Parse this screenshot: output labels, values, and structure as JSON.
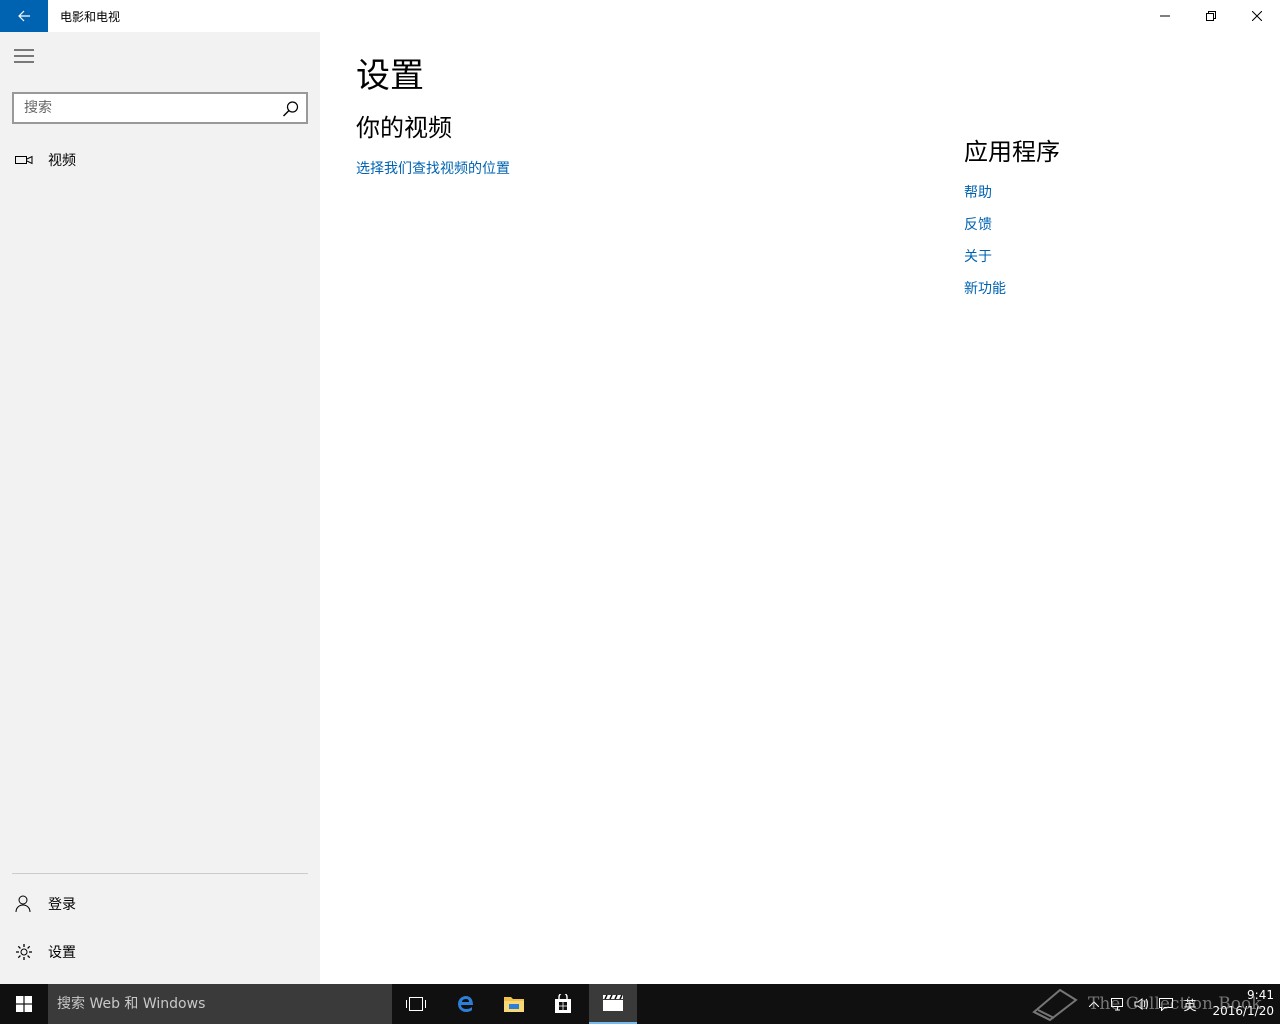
{
  "window": {
    "title": "电影和电视"
  },
  "sidebar": {
    "search_placeholder": "搜索",
    "nav": {
      "videos": "视频",
      "signin": "登录",
      "settings": "设置"
    }
  },
  "main": {
    "page_title": "设置",
    "your_videos": {
      "title": "你的视频",
      "choose_folders": "选择我们查找视频的位置"
    },
    "app": {
      "title": "应用程序",
      "help": "帮助",
      "feedback": "反馈",
      "about": "关于",
      "whats_new": "新功能"
    }
  },
  "taskbar": {
    "search_placeholder": "搜索 Web 和 Windows",
    "ime": "英",
    "time": "9:41",
    "date": "2016/1/20",
    "watermark": "The Collection Book"
  },
  "colors": {
    "accent": "#0063b1",
    "sidebar_bg": "#f2f2f2",
    "taskbar_bg": "#101010"
  }
}
